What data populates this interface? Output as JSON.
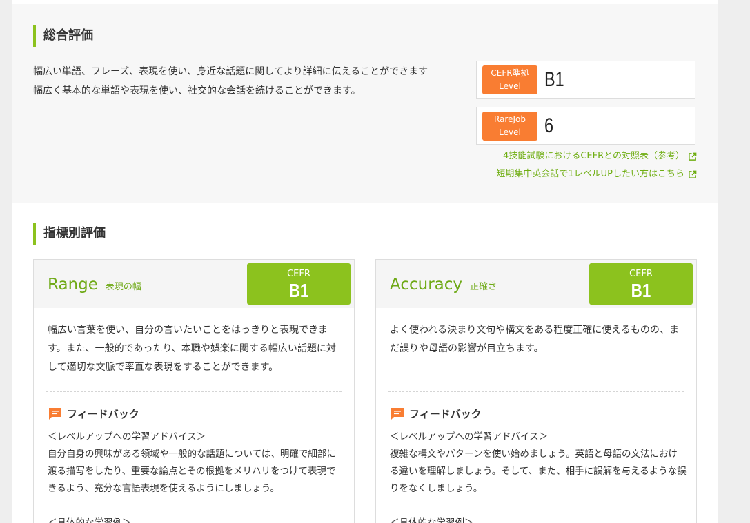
{
  "overall": {
    "title": "総合評価",
    "line1": "幅広い単語、フレーズ、表現を使い、身近な話題に関してより詳細に伝えることができます",
    "line2": "幅広く基本的な単語や表現を使い、社交的な会話を続けることができます。",
    "cefr": {
      "label_top": "CEFR準拠",
      "label_bottom": "Level",
      "value": "B1"
    },
    "rarejob": {
      "label_top": "RareJob",
      "label_bottom": "Level",
      "value": "6"
    },
    "link1": "4技能試験におけるCEFRとの対照表（参考）",
    "link2": "短期集中英会話で1レベルUPしたい方はこちら"
  },
  "indicators": {
    "title": "指標別評価",
    "cards": [
      {
        "name": "Range",
        "sub": "表現の幅",
        "cefr_label": "CEFR",
        "cefr_value": "B1",
        "description": "幅広い言葉を使い、自分の言いたいことをはっきりと表現できます。また、一般的であったり、本職や娯楽に関する幅広い話題に対して適切な文脈で率直な表現をすることができます。",
        "feedback_title": "フィードバック",
        "advice_heading": "＜レベルアップへの学習アドバイス＞",
        "advice": "自分自身の興味がある領域や一般的な話題については、明確で細部に渡る描写をしたり、重要な論点とその根拠をメリハリをつけて表現できるよう、充分な言語表現を使えるようにしましょう。",
        "examples_heading": "＜具体的な学習例＞"
      },
      {
        "name": "Accuracy",
        "sub": "正確さ",
        "cefr_label": "CEFR",
        "cefr_value": "B1",
        "description": "よく使われる決まり文句や構文をある程度正確に使えるものの、まだ誤りや母語の影響が目立ちます。",
        "feedback_title": "フィードバック",
        "advice_heading": "＜レベルアップへの学習アドバイス＞",
        "advice": "複雑な構文やパターンを使い始めましょう。英語と母語の文法における違いを理解しましょう。そして、また、相手に誤解を与えるような誤りをなくしましょう。",
        "examples_heading": "＜具体的な学習例＞"
      }
    ]
  },
  "icons": {
    "external": "external-link-icon",
    "feedback": "chat-bubble-icon"
  },
  "colors": {
    "accent_green": "#8cc21e",
    "accent_orange": "#f97d32",
    "link_green": "#6fae12"
  }
}
